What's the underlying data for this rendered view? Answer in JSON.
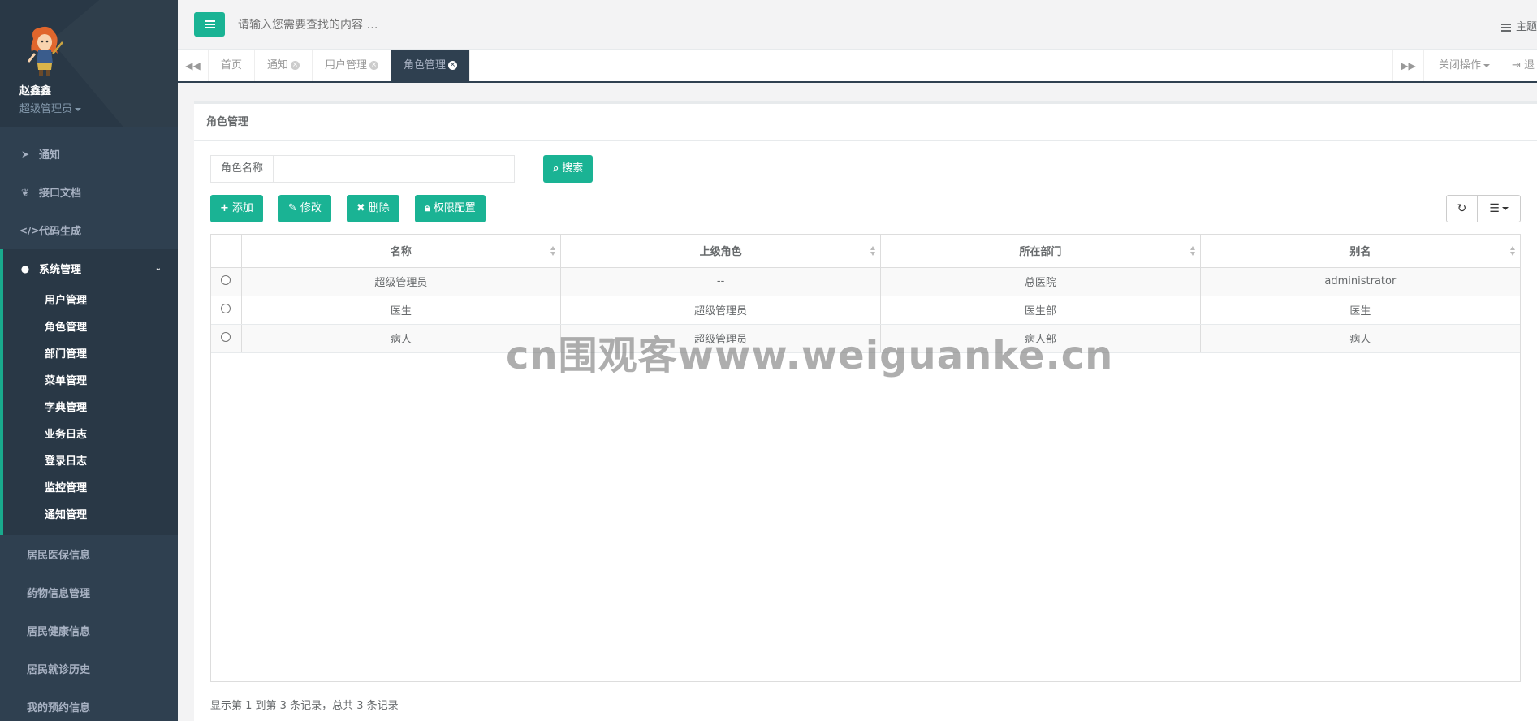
{
  "profile": {
    "name": "赵鑫鑫",
    "role": "超级管理员"
  },
  "sidebar": {
    "top_items": [
      {
        "label": "通知",
        "icon": "paper-plane-icon"
      },
      {
        "label": "接口文档",
        "icon": "leaf-icon"
      },
      {
        "label": "代码生成",
        "icon": "code-icon"
      }
    ],
    "active_group": {
      "label": "系统管理",
      "icon": "user-icon",
      "items": [
        "用户管理",
        "角色管理",
        "部门管理",
        "菜单管理",
        "字典管理",
        "业务日志",
        "登录日志",
        "监控管理",
        "通知管理"
      ]
    },
    "bottom_items": [
      "居民医保信息",
      "药物信息管理",
      "居民健康信息",
      "居民就诊历史",
      "我的预约信息"
    ]
  },
  "topbar": {
    "search_placeholder": "请输入您需要查找的内容 …",
    "theme_label": "主题"
  },
  "tabs": {
    "items": [
      {
        "label": "首页",
        "closable": false,
        "active": false
      },
      {
        "label": "通知",
        "closable": true,
        "active": false
      },
      {
        "label": "用户管理",
        "closable": true,
        "active": false
      },
      {
        "label": "角色管理",
        "closable": true,
        "active": true
      }
    ],
    "close_ops_label": "关闭操作",
    "exit_label": "退"
  },
  "panel": {
    "title": "角色管理",
    "search_label": "角色名称",
    "search_button": "搜索",
    "buttons": {
      "add": "添加",
      "edit": "修改",
      "delete": "删除",
      "permissions": "权限配置"
    }
  },
  "table": {
    "columns": [
      "名称",
      "上级角色",
      "所在部门",
      "别名"
    ],
    "rows": [
      [
        "超级管理员",
        "--",
        "总医院",
        "administrator"
      ],
      [
        "医生",
        "超级管理员",
        "医生部",
        "医生"
      ],
      [
        "病人",
        "超级管理员",
        "病人部",
        "病人"
      ]
    ]
  },
  "pager_info": "显示第 1 到第 3 条记录，总共 3 条记录",
  "watermark": "cn围观客www.weiguanke.cn",
  "colors": {
    "sidebar": "#2f4050",
    "accent": "#1ab394",
    "active_border": "#19aa8d"
  }
}
